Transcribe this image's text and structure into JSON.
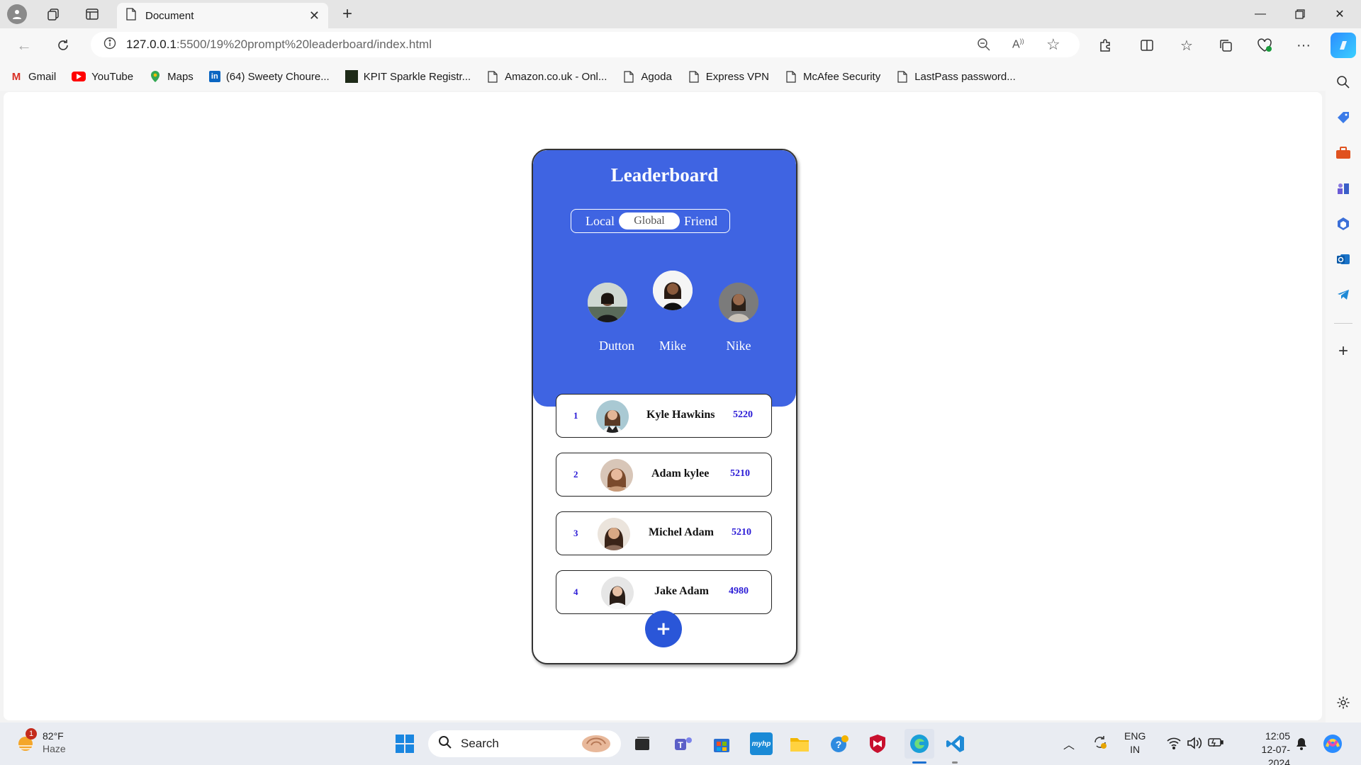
{
  "browser": {
    "tab_title": "Document",
    "url_host": "127.0.0.1",
    "url_rest": ":5500/19%20prompt%20leaderboard/index.html",
    "bookmarks": [
      {
        "label": "Gmail",
        "icon": "gmail-icon"
      },
      {
        "label": "YouTube",
        "icon": "youtube-icon"
      },
      {
        "label": "Maps",
        "icon": "maps-icon"
      },
      {
        "label": "(64) Sweety Choure...",
        "icon": "linkedin-icon"
      },
      {
        "label": "KPIT Sparkle Registr...",
        "icon": "kpit-icon"
      },
      {
        "label": "Amazon.co.uk - Onl...",
        "icon": "page-icon"
      },
      {
        "label": "Agoda",
        "icon": "page-icon"
      },
      {
        "label": "Express VPN",
        "icon": "page-icon"
      },
      {
        "label": "McAfee Security",
        "icon": "page-icon"
      },
      {
        "label": "LastPass password...",
        "icon": "page-icon"
      }
    ]
  },
  "leaderboard": {
    "title": "Leaderboard",
    "tabs": {
      "local": "Local",
      "global": "Global",
      "friend": "Friend",
      "selected": "Global"
    },
    "top3": [
      {
        "name": "Dutton"
      },
      {
        "name": "Mike"
      },
      {
        "name": "Nike"
      }
    ],
    "rows": [
      {
        "rank": "1",
        "name": "Kyle Hawkins",
        "score": "5220"
      },
      {
        "rank": "2",
        "name": "Adam kylee",
        "score": "5210"
      },
      {
        "rank": "3",
        "name": "Michel Adam",
        "score": "5210"
      },
      {
        "rank": "4",
        "name": "Jake Adam",
        "score": "4980"
      }
    ],
    "add_label": "+",
    "colors": {
      "accent": "#3f64e2",
      "rank_score": "#2a1ad6"
    }
  },
  "taskbar": {
    "weather_temp": "82°F",
    "weather_desc": "Haze",
    "weather_badge": "1",
    "search_placeholder": "Search",
    "lang_top": "ENG",
    "lang_bottom": "IN",
    "time": "12:05",
    "date": "12-07-2024"
  }
}
